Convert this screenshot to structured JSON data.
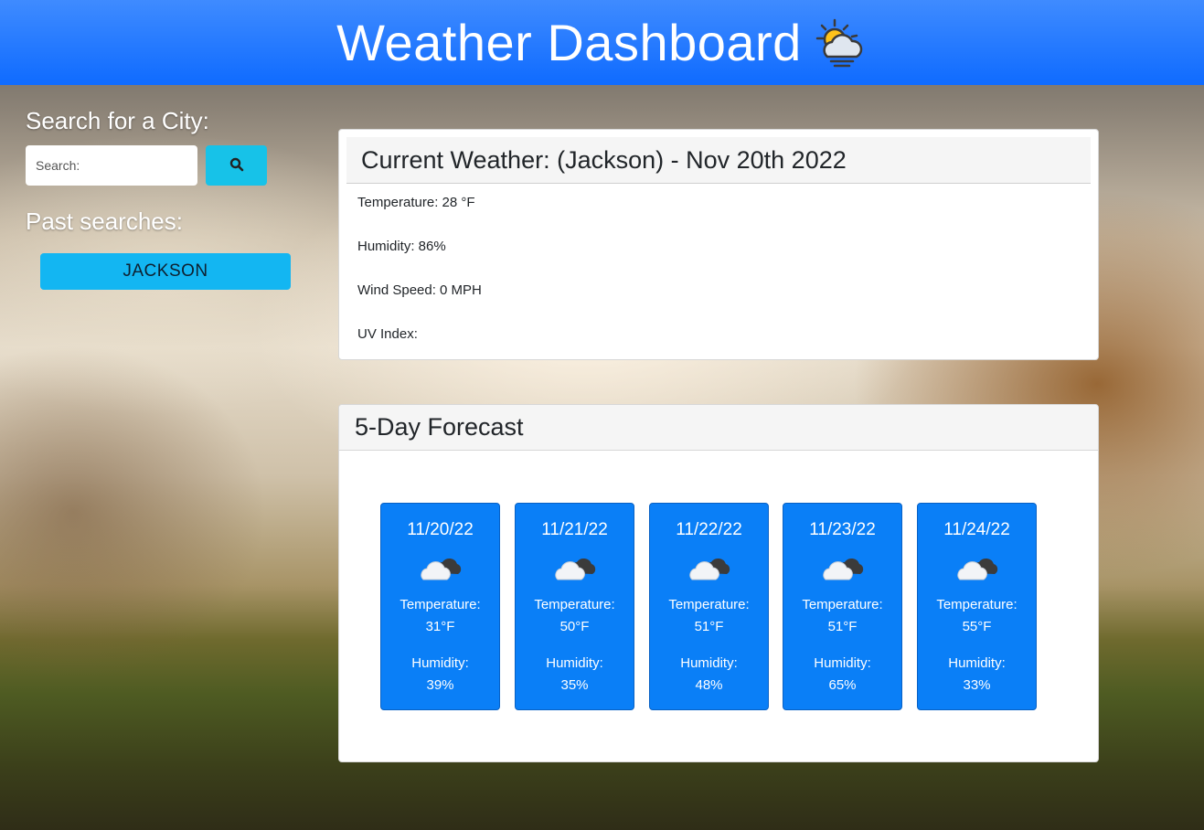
{
  "header": {
    "title": "Weather Dashboard",
    "icon": "sun-behind-cloud-icon"
  },
  "sidebar": {
    "search_heading": "Search for a City:",
    "search_placeholder": "Search:",
    "search_value": "",
    "search_button_icon": "search-icon",
    "past_heading": "Past searches:",
    "past_searches": [
      "JACKSON"
    ]
  },
  "current": {
    "title": "Current Weather: (Jackson) - Nov 20th 2022",
    "temperature": "Temperature: 28 °F",
    "humidity": "Humidity: 86%",
    "wind": "Wind Speed: 0 MPH",
    "uv": "UV Index:"
  },
  "forecast": {
    "title": "5-Day Forecast",
    "temp_label": "Temperature:",
    "humidity_label": "Humidity:",
    "days": [
      {
        "date": "11/20/22",
        "icon": "cloud-icon",
        "temp": "31°F",
        "humidity": "39%"
      },
      {
        "date": "11/21/22",
        "icon": "cloud-icon",
        "temp": "50°F",
        "humidity": "35%"
      },
      {
        "date": "11/22/22",
        "icon": "cloud-icon",
        "temp": "51°F",
        "humidity": "48%"
      },
      {
        "date": "11/23/22",
        "icon": "cloud-icon",
        "temp": "51°F",
        "humidity": "65%"
      },
      {
        "date": "11/24/22",
        "icon": "cloud-icon",
        "temp": "55°F",
        "humidity": "33%"
      }
    ]
  },
  "colors": {
    "header": "#1a73ff",
    "search_button": "#17c2e8",
    "past_button": "#13b6f2",
    "forecast_card": "#0a7ff7"
  }
}
